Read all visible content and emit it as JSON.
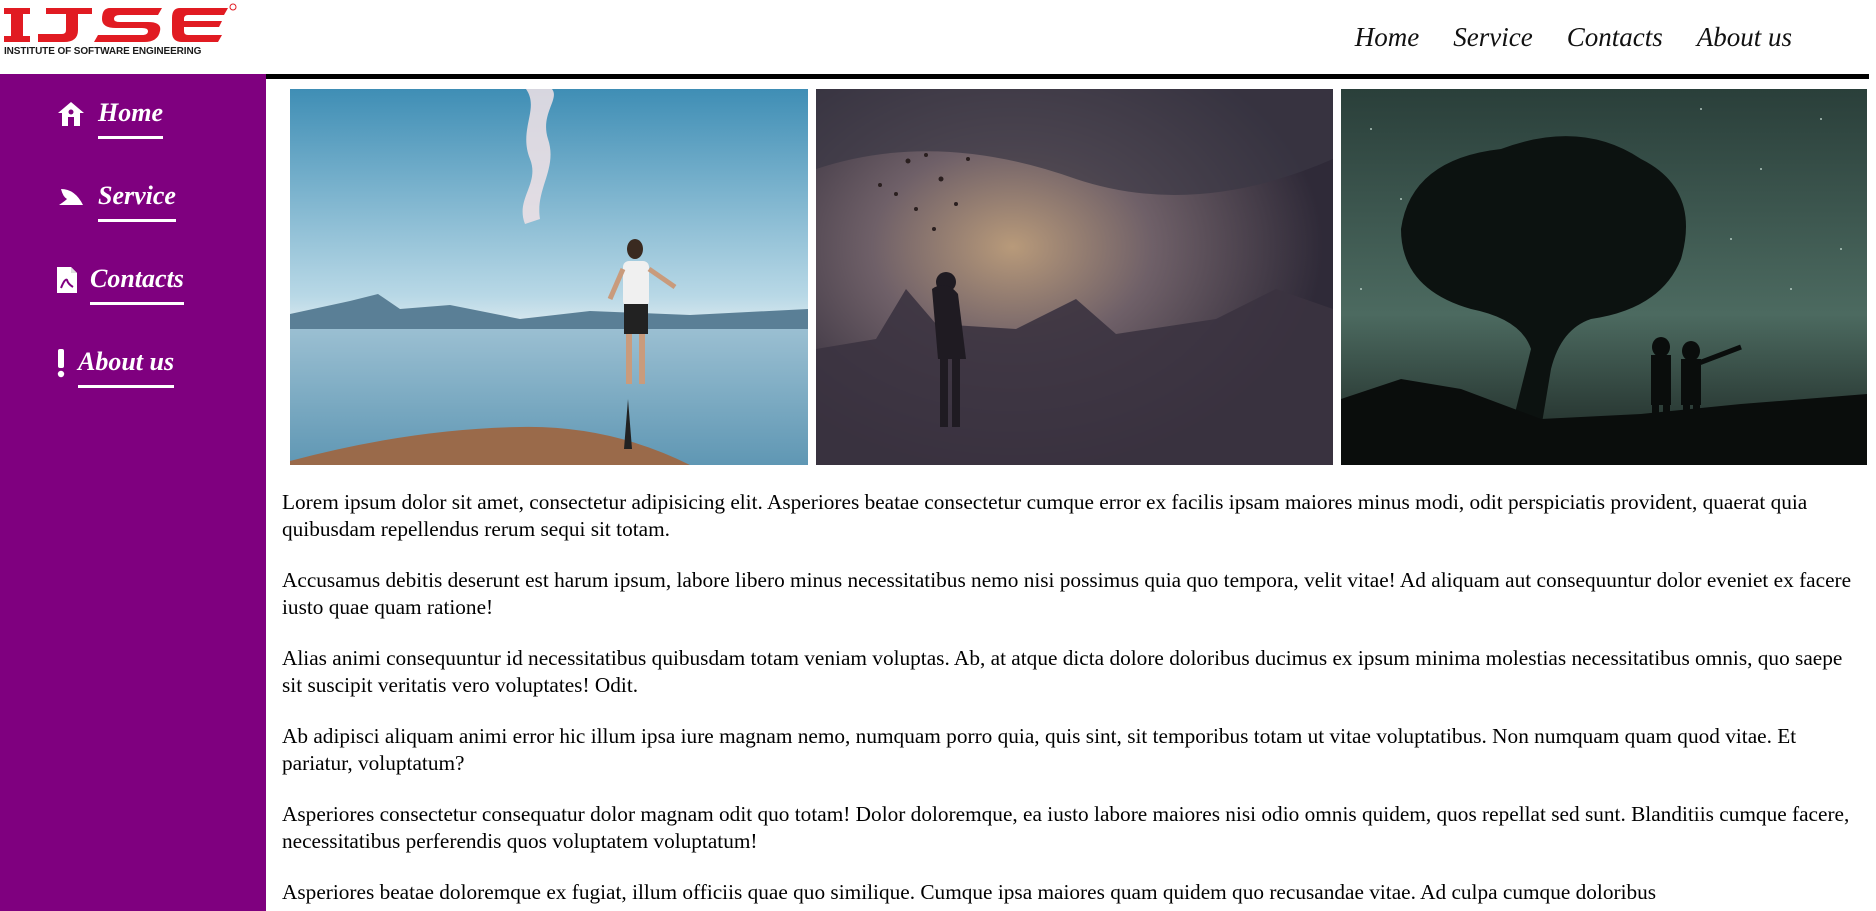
{
  "brand": {
    "logo_text": "IJSE",
    "caption": "INSTITUTE OF SOFTWARE ENGINEERING",
    "color": "#e11b22"
  },
  "top_nav": {
    "items": [
      {
        "label": "Home"
      },
      {
        "label": "Service"
      },
      {
        "label": "Contacts"
      },
      {
        "label": "About us"
      }
    ]
  },
  "sidebar": {
    "background": "#7f007f",
    "items": [
      {
        "label": "Home",
        "icon": "home-icon"
      },
      {
        "label": "Service",
        "icon": "service-icon"
      },
      {
        "label": "Contacts",
        "icon": "contact-document-icon"
      },
      {
        "label": "About us",
        "icon": "exclamation-icon"
      }
    ]
  },
  "gallery": {
    "images": [
      {
        "name": "person-on-cliff-by-lake-photo"
      },
      {
        "name": "silhouette-under-dusk-sky-photo"
      },
      {
        "name": "children-under-tree-night-sky-photo"
      }
    ]
  },
  "content": {
    "paragraphs": [
      "Lorem ipsum dolor sit amet, consectetur adipisicing elit. Asperiores beatae consectetur cumque error ex facilis ipsam maiores minus modi, odit perspiciatis provident, quaerat quia quibusdam repellendus rerum sequi sit totam.",
      "Accusamus debitis deserunt est harum ipsum, labore libero minus necessitatibus nemo nisi possimus quia quo tempora, velit vitae! Ad aliquam aut consequuntur dolor eveniet ex facere iusto quae quam ratione!",
      "Alias animi consequuntur id necessitatibus quibusdam totam veniam voluptas. Ab, at atque dicta dolore doloribus ducimus ex ipsum minima molestias necessitatibus omnis, quo saepe sit suscipit veritatis vero voluptates! Odit.",
      "Ab adipisci aliquam animi error hic illum ipsa iure magnam nemo, numquam porro quia, quis sint, sit temporibus totam ut vitae voluptatibus. Non numquam quam quod vitae. Et pariatur, voluptatum?",
      "Asperiores consectetur consequatur dolor magnam odit quo totam! Dolor doloremque, ea iusto labore maiores nisi odio omnis quidem, quos repellat sed sunt. Blanditiis cumque facere, necessitatibus perferendis quos voluptatem voluptatum!",
      "Asperiores beatae doloremque ex fugiat, illum officiis quae quo similique. Cumque ipsa maiores quam quidem quo recusandae vitae. Ad culpa cumque doloribus"
    ]
  }
}
